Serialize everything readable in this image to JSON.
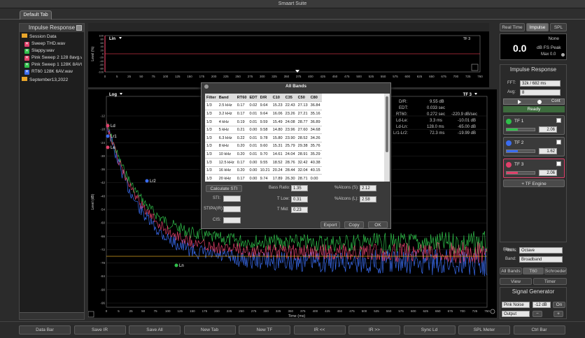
{
  "window": {
    "title": "Smaart Suite"
  },
  "tabs": [
    {
      "label": "Default Tab"
    }
  ],
  "impulse_panel": {
    "title": "Impulse Response",
    "session_label": "Session Data",
    "files": [
      {
        "name": "Sweep THD.wav",
        "color": "#e0406a"
      },
      {
        "name": "Slappy.wav",
        "color": "#2fbf4a"
      },
      {
        "name": "Pink Sweep 2 128 8avg.wav",
        "color": "#e0406a"
      },
      {
        "name": "Pink Sweep 1 128K 8AVG.wav",
        "color": "#2fbf4a"
      },
      {
        "name": "RT60 128K 6AV.wav",
        "color": "#3a6cf0"
      }
    ],
    "folder2": "September13,2022"
  },
  "top_plot": {
    "scale": "Lin",
    "tf_label": "TF 3",
    "ylabel": "Level (%)",
    "yticks": [
      "100",
      "80",
      "60",
      "40",
      "20",
      "0",
      "-20",
      "-40",
      "-60",
      "-80",
      "-100"
    ],
    "xticks": [
      "0",
      "5",
      "25",
      "50",
      "75",
      "100",
      "125",
      "150",
      "175",
      "200",
      "225",
      "250",
      "275",
      "300",
      "325",
      "350",
      "375",
      "400",
      "425",
      "450",
      "475",
      "500",
      "525",
      "550",
      "575",
      "600",
      "625",
      "650",
      "675",
      "700",
      "725",
      "760"
    ]
  },
  "main_plot": {
    "scale": "Log",
    "tf_label": "TF 3",
    "ylabel": "Level (dB)",
    "xlabel": "Time (ms)",
    "yticks": [
      "-12",
      "-18",
      "-24",
      "-30",
      "-36",
      "-42",
      "-48",
      "-54",
      "-60",
      "-66",
      "-72",
      "-78",
      "-84",
      "-90",
      "-96"
    ],
    "xticks": [
      "0",
      "5",
      "25",
      "50",
      "75",
      "100",
      "125",
      "150",
      "175",
      "200",
      "225",
      "250",
      "275",
      "300",
      "325",
      "350",
      "375",
      "400",
      "425",
      "450",
      "475",
      "500",
      "525",
      "550",
      "575",
      "600",
      "625",
      "650",
      "675",
      "700",
      "725",
      "750"
    ],
    "markers": [
      {
        "label": "Ld"
      },
      {
        "label": "Lr1"
      },
      {
        "label": "Le"
      },
      {
        "label": "Lr2"
      },
      {
        "label": "Ln"
      }
    ]
  },
  "metrics": {
    "dr_label": "D/R:",
    "dr": "9.55 dB",
    "edt_label": "EDT:",
    "edt": "0.033 sec",
    "rt60_label": "RT60:",
    "rt60": "0.272 sec",
    "rt60_rate": "-220.9 dB/sec",
    "ldle_label": "Ld-Le:",
    "ldle_ms": "3.3 ms",
    "ldle_db": "-10.01 dB",
    "ldln_label": "Ld-Ln:",
    "ldln_ms": "128.0 ms",
    "ldln_db": "-65.00 dB",
    "lr1lr2_label": "Lr1-Lr2:",
    "lr1lr2_ms": "72.3 ms",
    "lr1lr2_db": "-19.99 dB"
  },
  "bands_dialog": {
    "title": "All Bands",
    "columns": [
      "Filter",
      "Band",
      "RT60",
      "EDT",
      "D/R",
      "C10",
      "C35",
      "C50",
      "C80"
    ],
    "rows": [
      [
        "1/3",
        "2.5 kHz",
        "0.17",
        "0.02",
        "9.64",
        "15.23",
        "22.43",
        "27.13",
        "36.84"
      ],
      [
        "1/3",
        "3.2 kHz",
        "0.17",
        "0.01",
        "9.64",
        "16.06",
        "23.26",
        "27.21",
        "35.16"
      ],
      [
        "1/3",
        "4 kHz",
        "0.19",
        "0.01",
        "9.59",
        "15.49",
        "24.08",
        "28.77",
        "36.89"
      ],
      [
        "1/3",
        "5 kHz",
        "0.21",
        "0.00",
        "9.58",
        "14.80",
        "23.96",
        "27.60",
        "34.68"
      ],
      [
        "1/3",
        "6.3 kHz",
        "0.22",
        "0.01",
        "9.78",
        "15.80",
        "23.90",
        "28.52",
        "34.26"
      ],
      [
        "1/3",
        "8 kHz",
        "0.20",
        "0.01",
        "9.60",
        "15.31",
        "25.79",
        "29.38",
        "35.76"
      ],
      [
        "1/3",
        "10 kHz",
        "0.20",
        "0.01",
        "9.70",
        "14.61",
        "24.04",
        "28.91",
        "35.29"
      ],
      [
        "1/3",
        "12.5 kHz",
        "0.17",
        "0.00",
        "9.55",
        "18.52",
        "28.76",
        "32.42",
        "40.38"
      ],
      [
        "1/3",
        "16 kHz",
        "0.20",
        "0.00",
        "10.21",
        "20.24",
        "28.44",
        "32.04",
        "40.15"
      ],
      [
        "1/3",
        "20 kHz",
        "0.17",
        "0.00",
        "9.74",
        "17.89",
        "26.30",
        "28.71",
        "0.00"
      ]
    ],
    "calc_sti": "Calculate STI",
    "sti_label": "STI:",
    "stipa_label": "STIPA(IR):",
    "cis_label": "CIS:",
    "bass_ratio_label": "Bass Ratio:",
    "bass_ratio": "1.35",
    "t_low_label": "T Low:",
    "t_low": "0.31",
    "t_mid_label": "T Mid:",
    "t_mid": "0.23",
    "alcons_s_label": "%Alcons (S):",
    "alcons_s": "2.12",
    "alcons_l_label": "%Alcons (L):",
    "alcons_l": "2.58",
    "export": "Export",
    "copy": "Copy",
    "ok": "OK"
  },
  "right_panel": {
    "buttons": [
      "Real Time",
      "Impulse",
      "SPL"
    ],
    "meter": {
      "value": "0.0",
      "unit": "dB FS Peak",
      "none": "None",
      "max": "Max 0.0"
    },
    "ir_title": "Impulse Response",
    "fft_label": "FFT:",
    "fft": "32k / 682 ms",
    "avg_label": "Avg:",
    "avg": "8",
    "cont": "Cont",
    "ready": "Ready",
    "tfs": [
      {
        "name": "TF 1",
        "value": "2.06",
        "color": "#2fbf4a"
      },
      {
        "name": "TF 2",
        "value": "1.62",
        "color": "#3a6cf0"
      },
      {
        "name": "TF 3",
        "value": "2.06",
        "color": "#e0406a"
      }
    ],
    "tf_engine": "+ TF Engine",
    "filters_label": "Filters:",
    "filters": "Octave",
    "band_label": "Band:",
    "band": "Broadband",
    "view_tabs": [
      "All Bands",
      "T60",
      "Schroeder"
    ],
    "view": "View",
    "timer": "Timer",
    "sig_title": "Signal Generator",
    "sig_type": "Pink Noise",
    "sig_level": "-12 dB",
    "sig_on": "On",
    "output": "Output"
  },
  "bottom_bar": [
    "Data Bar",
    "Save IR",
    "Save All",
    "New Tab",
    "New TF",
    "IR <<",
    "IR >>",
    "Sync Ld",
    "SPL Meter",
    "Ctrl Bar"
  ]
}
